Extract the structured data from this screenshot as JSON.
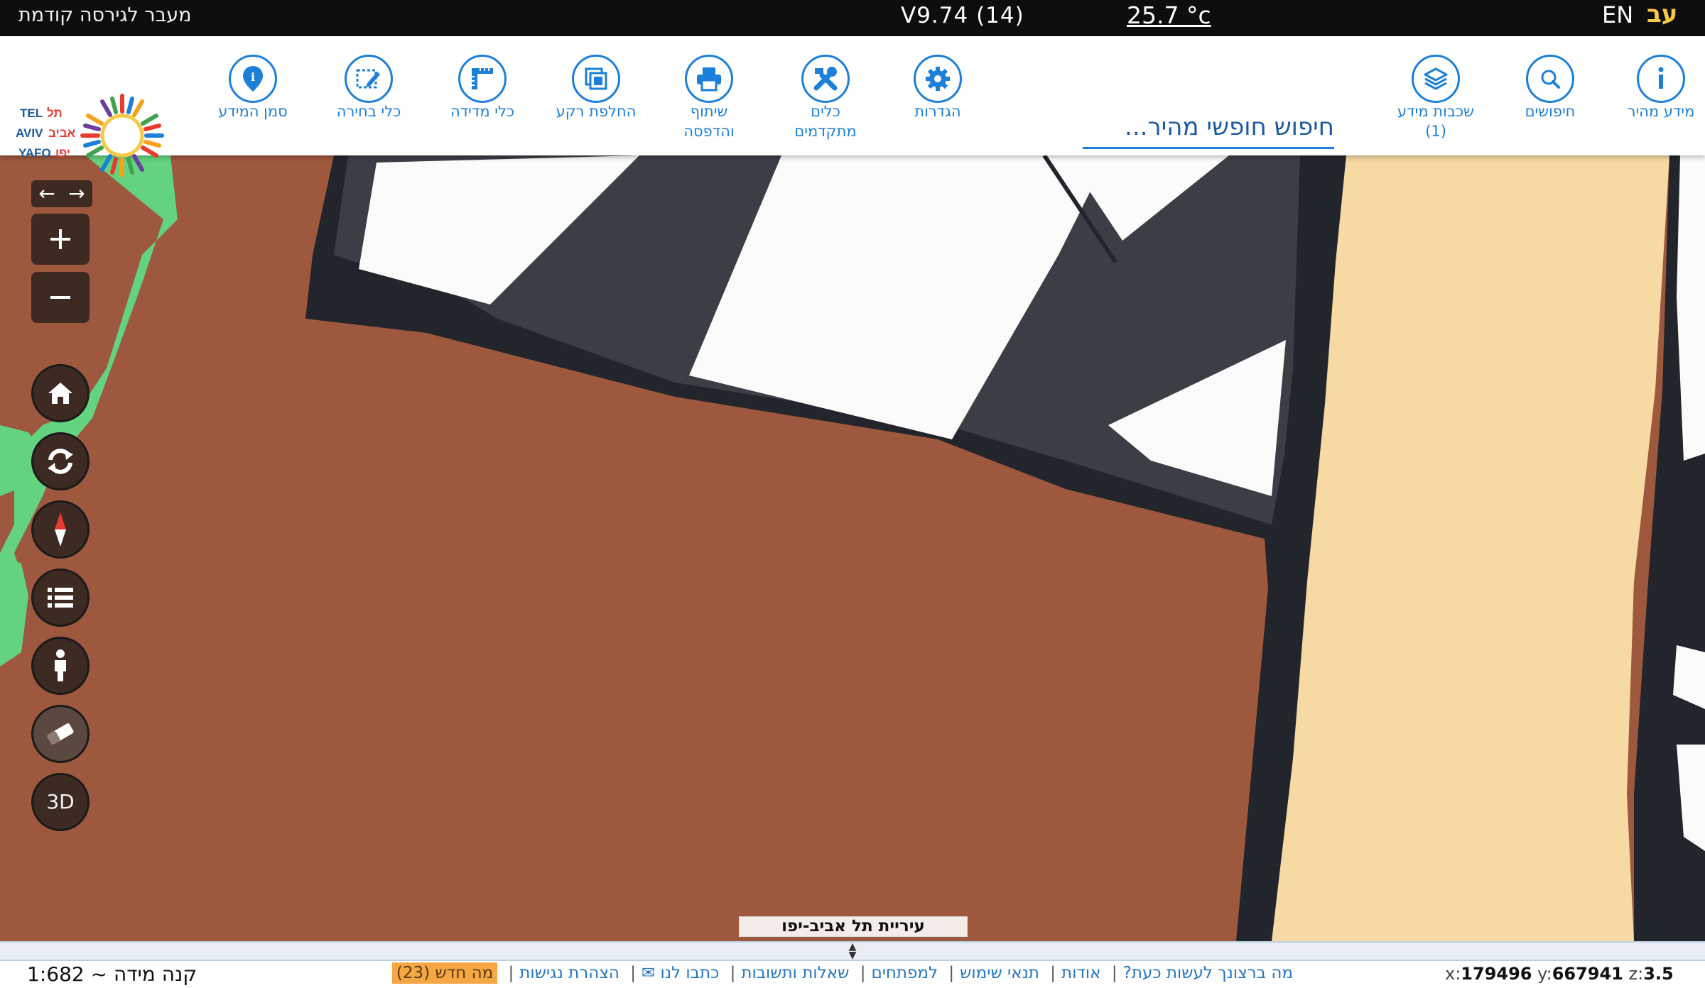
{
  "topbar": {
    "prev_version": "מעבר לגירסה קודמת",
    "version": "V9.74 (14)",
    "temperature": "25.7 °c",
    "lang_en": "EN",
    "lang_he": "עב"
  },
  "toolbar": {
    "logo_text": [
      "TEL",
      "תל",
      "AVIV",
      "אביב",
      "YAFO",
      "יפו"
    ],
    "tools": [
      {
        "label": "מידע מהיר",
        "icon": "info-icon"
      },
      {
        "label": "חיפושים",
        "icon": "search-icon"
      },
      {
        "label": "שכבות מידע (1)",
        "icon": "layers-icon"
      },
      {
        "label": "הגדרות",
        "icon": "gear-icon"
      },
      {
        "label": "כלים מתקדמים",
        "icon": "tools-icon"
      },
      {
        "label": "שיתוף והדפסה",
        "icon": "printer-icon"
      },
      {
        "label": "החלפת רקע",
        "icon": "basemap-icon"
      },
      {
        "label": "כלי מדידה",
        "icon": "ruler-icon"
      },
      {
        "label": "כלי בחירה",
        "icon": "select-icon"
      },
      {
        "label": "סמן המידע",
        "icon": "marker-icon"
      }
    ],
    "search_placeholder": "חיפוש חופשי מהיר..."
  },
  "map": {
    "city_label": "עיריית תל אביב-יפו",
    "controls": [
      "previous-extent",
      "next-extent",
      "zoom-in",
      "zoom-out",
      "home",
      "refresh",
      "compass",
      "legend",
      "street-view",
      "eraser",
      "3D"
    ],
    "control_3d_label": "3D",
    "colors": {
      "built_area": "#9e583d",
      "road": "#3b3e45",
      "open_space": "#fbfbfb",
      "sand": "#f6d9a3",
      "green": "#63d37f",
      "outline": "#22252b"
    }
  },
  "footer": {
    "scale": "קנה מידה ~ 1:682",
    "links": [
      "מה ברצונך לעשות כעת?",
      "אודות",
      "תנאי שימוש",
      "למפתחים",
      "שאלות ותשובות",
      "כתבו לנו ✉",
      "הצהרת נגישות"
    ],
    "whats_new": "מה חדש (23)",
    "coords": {
      "x_label": "x:",
      "x": "179496",
      "y_label": "y:",
      "y": "667941",
      "z_label": "z:",
      "z": "3.5"
    }
  }
}
